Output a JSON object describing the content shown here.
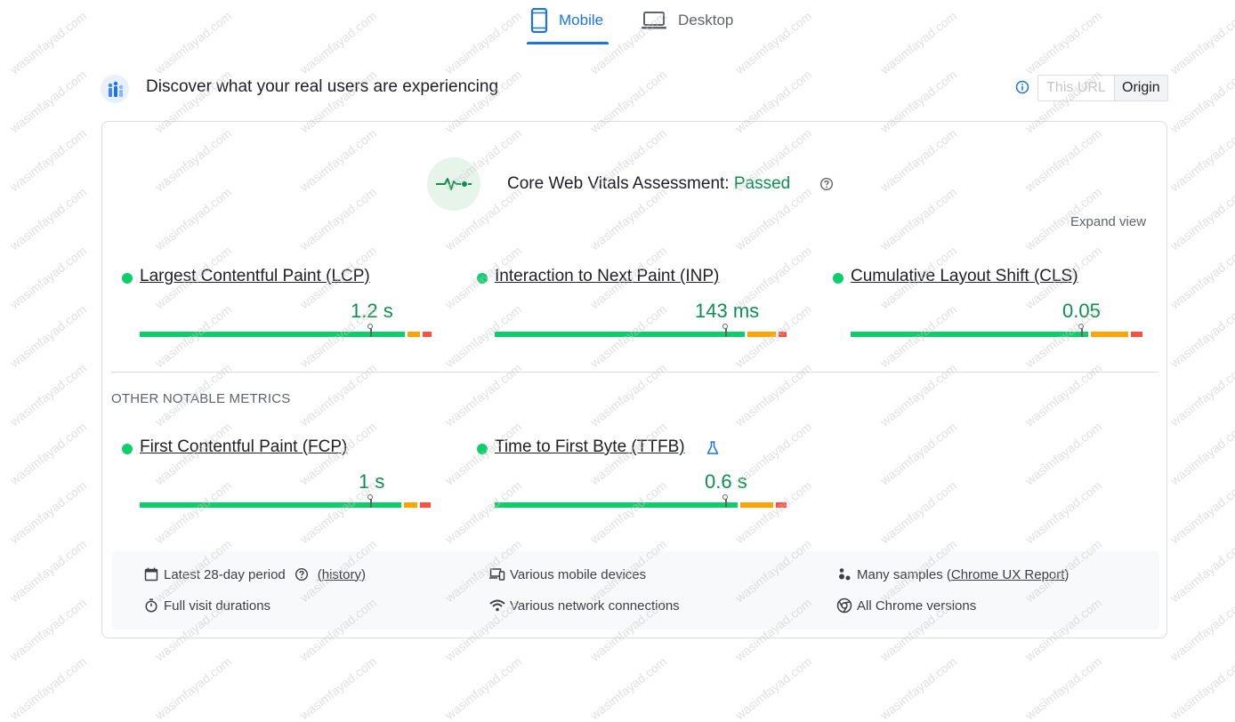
{
  "tabs": [
    {
      "label": "Mobile",
      "icon": "phone-icon",
      "active": true
    },
    {
      "label": "Desktop",
      "icon": "laptop-icon",
      "active": false
    }
  ],
  "header": {
    "title": "Discover what your real users are experiencing",
    "toggle": {
      "url_label": "This URL",
      "origin_label": "Origin",
      "selected": "Origin"
    }
  },
  "assessment": {
    "label": "Core Web Vitals Assessment:",
    "status": "Passed",
    "status_color": "#0d904f",
    "expand_label": "Expand view"
  },
  "core_metrics": [
    {
      "name": "Largest Contentful Paint (LCP)",
      "value": "1.2 s",
      "marker_fraction": 0.79,
      "dist": [
        0.88,
        0.04,
        0.03
      ]
    },
    {
      "name": "Interaction to Next Paint (INP)",
      "value": "143 ms",
      "marker_fraction": 0.79,
      "dist": [
        0.89,
        0.1,
        0.03
      ]
    },
    {
      "name": "Cumulative Layout Shift (CLS)",
      "value": "0.05",
      "marker_fraction": 0.79,
      "dist": [
        0.83,
        0.13,
        0.04
      ]
    }
  ],
  "other_heading": "OTHER NOTABLE METRICS",
  "other_metrics": [
    {
      "name": "First Contentful Paint (FCP)",
      "value": "1 s",
      "marker_fraction": 0.79,
      "dist": [
        0.96,
        0.05,
        0.04
      ]
    },
    {
      "name": "Time to First Byte (TTFB)",
      "value": "0.6 s",
      "marker_fraction": 0.79,
      "dist": [
        0.89,
        0.12,
        0.04
      ],
      "experimental": true
    }
  ],
  "footer": {
    "period": "Latest 28-day period",
    "history": "(history)",
    "durations": "Full visit durations",
    "devices": "Various mobile devices",
    "network": "Various network connections",
    "samples_prefix": "Many samples (",
    "samples_link": "Chrome UX Report",
    "samples_suffix": ")",
    "versions": "All Chrome versions"
  },
  "watermark": "wasimfayad.com",
  "colors": {
    "accent": "#1a73e8",
    "good": "#0cce6b",
    "needs_improvement": "#ffa400",
    "poor": "#ff4e42"
  }
}
